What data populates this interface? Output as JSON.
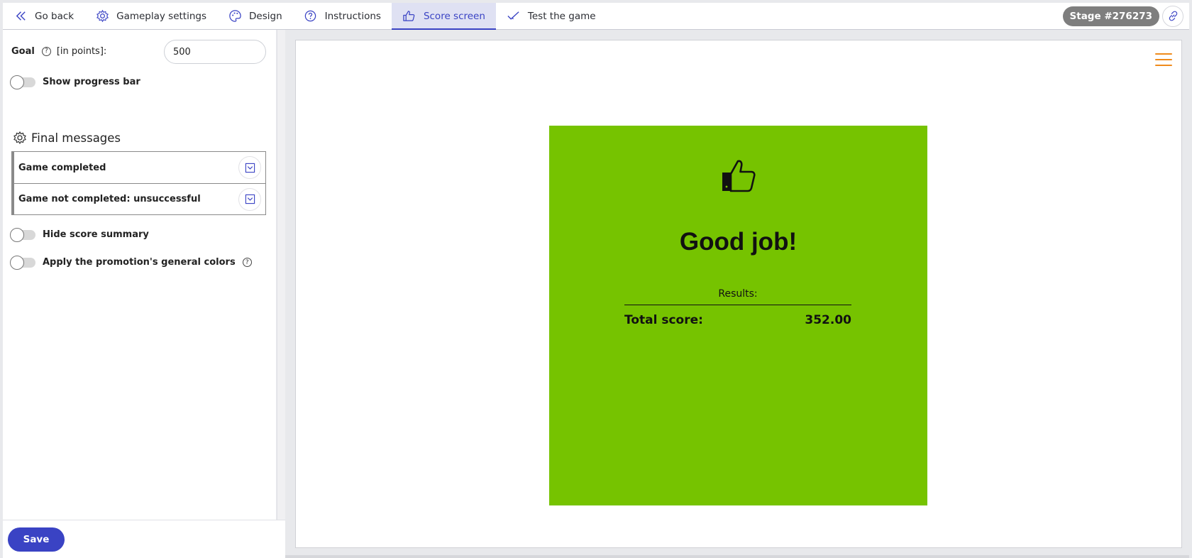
{
  "nav": {
    "items": [
      {
        "label": "Go back",
        "icon": "chevrons-left-icon"
      },
      {
        "label": "Gameplay settings",
        "icon": "gear-icon"
      },
      {
        "label": "Design",
        "icon": "palette-icon"
      },
      {
        "label": "Instructions",
        "icon": "help-circle-icon"
      },
      {
        "label": "Score screen",
        "icon": "thumbs-up-icon",
        "active": true
      },
      {
        "label": "Test the game",
        "icon": "check-icon"
      }
    ],
    "stage_badge": "Stage #276273",
    "link_icon": "link-icon"
  },
  "settings": {
    "goal_label": "Goal",
    "goal_unit": "[in points]:",
    "goal_value": "500",
    "show_progress_bar": "Show progress bar",
    "final_messages_title": "Final messages",
    "messages": [
      "Game completed",
      "Game not completed: unsuccessful"
    ],
    "hide_score_summary": "Hide score summary",
    "apply_colors": "Apply the promotion's general colors",
    "help_glyph": "?",
    "save_label": "Save"
  },
  "preview": {
    "title": "Good job!",
    "results_label": "Results:",
    "score_label": "Total score:",
    "score_value": "352.00",
    "card_color": "#76c300",
    "menu_color": "#ef8b1c"
  },
  "colors": {
    "accent": "#3a43c4",
    "badge": "#7e7e7e"
  }
}
